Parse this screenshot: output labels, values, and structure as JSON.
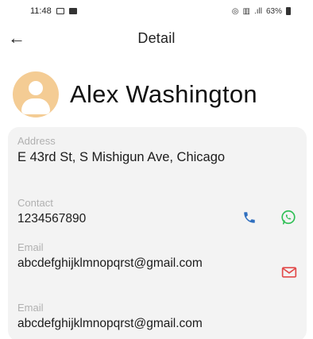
{
  "status_bar": {
    "time": "11:48",
    "right_text": "63%"
  },
  "header": {
    "title": "Detail"
  },
  "profile": {
    "name": "Alex Washington"
  },
  "fields": {
    "address_label": "Address",
    "address_value": "E 43rd St, S Mishigun Ave, Chicago",
    "contact_label": "Contact",
    "contact_value": "1234567890",
    "email1_label": "Email",
    "email1_value": "abcdefghijklmnopqrst@gmail.com",
    "email2_label": "Email",
    "email2_value": "abcdefghijklmnopqrst@gmail.com"
  },
  "colors": {
    "avatar_bg": "#f4cc94",
    "phone_icon": "#2f6fbf",
    "whatsapp_icon": "#2fbf55",
    "mail_icon": "#e24a4a",
    "card_bg": "#f3f3f3"
  },
  "icons": {
    "back": "arrow-left-icon",
    "phone": "phone-icon",
    "whatsapp": "whatsapp-icon",
    "mail": "mail-icon"
  }
}
